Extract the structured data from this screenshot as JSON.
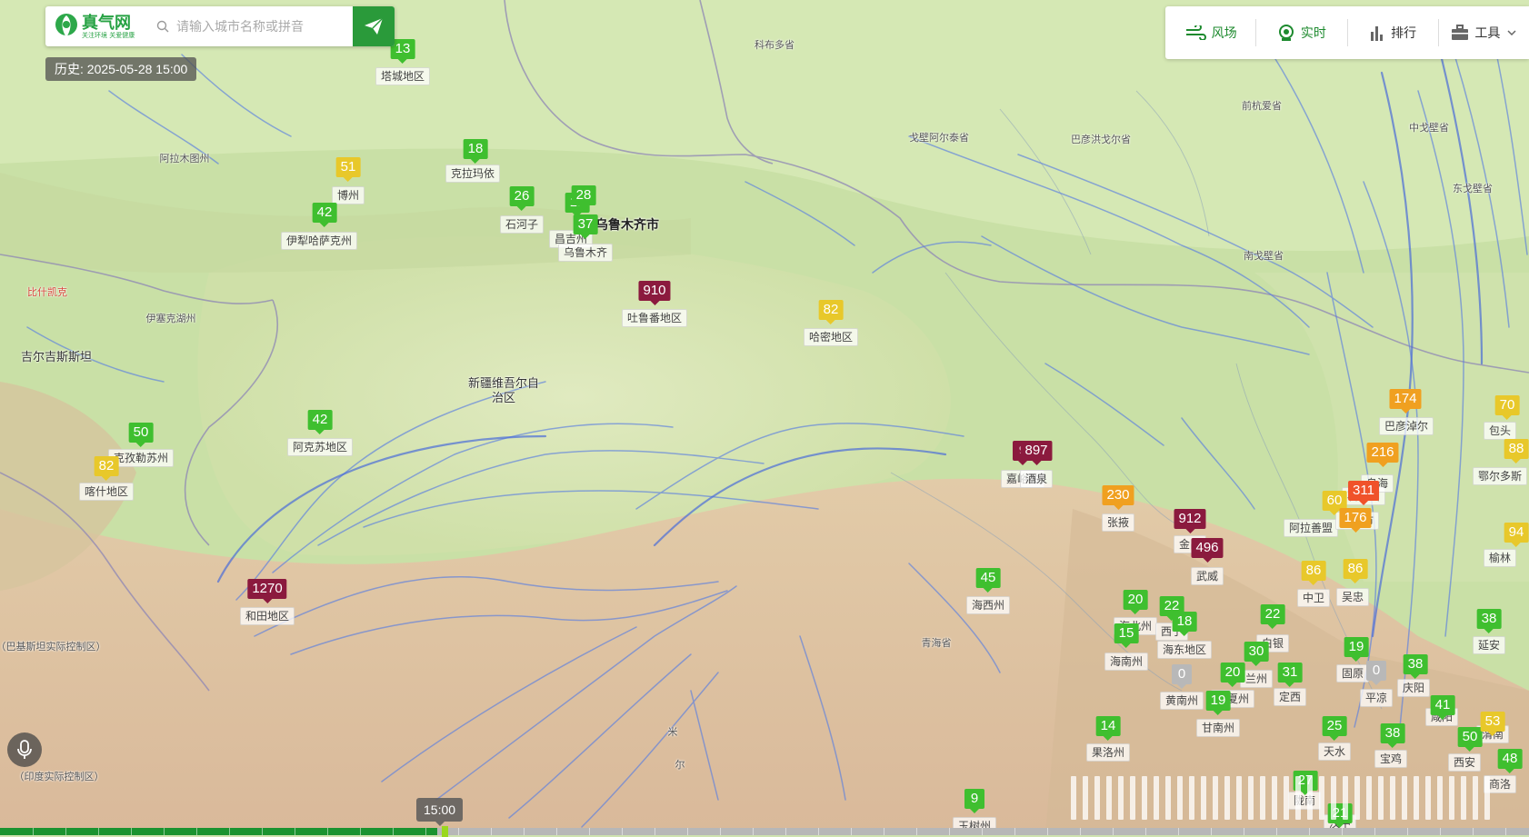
{
  "app": {
    "logo_title": "真气网",
    "logo_slogan": "关注环境 关爱健康",
    "search_placeholder": "请输入城市名称或拼音",
    "history_label": "历史: 2025-05-28 15:00"
  },
  "toolbar": [
    {
      "label": "风场",
      "icon": "wind-icon",
      "active": true
    },
    {
      "label": "实时",
      "icon": "monitor-icon",
      "active": true
    },
    {
      "label": "排行",
      "icon": "bar-chart-icon",
      "active": false
    },
    {
      "label": "工具",
      "icon": "toolbox-icon",
      "active": false
    }
  ],
  "timeline": {
    "current_time": "15:00"
  },
  "aqi_colors": {
    "good": "#3fbf2f",
    "moderate": "#e8c82a",
    "sensitive": "#f0a020",
    "unhealthy": "#f0522a",
    "very_unhealthy": "#b0245a",
    "hazardous": "#8b1a3e",
    "no_data": "#b8b8b8"
  },
  "regions": [
    "科布多省",
    "戈壁阿尔泰省",
    "巴彦洪戈尔省",
    "前杭爱省",
    "中戈壁省",
    "东戈壁省",
    "南戈壁省",
    "阿拉木图州",
    "伊塞克湖州",
    "吉尔吉斯斯坦",
    "比什凯克",
    "新疆维吾尔自治区",
    "青海省",
    "（巴基斯坦实际控制区）",
    "（印度实际控制区）",
    "米",
    "尔",
    "乌鲁木齐市",
    "吐鲁番地区"
  ],
  "stations": [
    {
      "name": "塔城地区",
      "aqi": 13,
      "level": "good"
    },
    {
      "name": "博州",
      "aqi": 51,
      "level": "moderate"
    },
    {
      "name": "伊犁哈萨克州",
      "aqi": 42,
      "level": "good"
    },
    {
      "name": "克拉玛依",
      "aqi": 18,
      "level": "good"
    },
    {
      "name": "石河子",
      "aqi": 26,
      "level": "good"
    },
    {
      "name": "昌吉州",
      "aqi": 19,
      "level": "good"
    },
    {
      "name": "",
      "aqi": 28,
      "level": "good"
    },
    {
      "name": "乌鲁木齐",
      "aqi": 37,
      "level": "good"
    },
    {
      "name": "吐鲁番地区",
      "aqi": 910,
      "level": "hazardous"
    },
    {
      "name": "哈密地区",
      "aqi": 82,
      "level": "moderate"
    },
    {
      "name": "克孜勒苏州",
      "aqi": 50,
      "level": "good"
    },
    {
      "name": "喀什地区",
      "aqi": 82,
      "level": "moderate"
    },
    {
      "name": "阿克苏地区",
      "aqi": 42,
      "level": "good"
    },
    {
      "name": "和田地区",
      "aqi": 1270,
      "level": "hazardous"
    },
    {
      "name": "嘉峪关",
      "aqi": 9,
      "level": "hazardous"
    },
    {
      "name": "酒泉",
      "aqi": 897,
      "level": "hazardous"
    },
    {
      "name": "张掖",
      "aqi": 230,
      "level": "sensitive"
    },
    {
      "name": "金昌",
      "aqi": 912,
      "level": "hazardous"
    },
    {
      "name": "武威",
      "aqi": 496,
      "level": "hazardous"
    },
    {
      "name": "海西州",
      "aqi": 45,
      "level": "good"
    },
    {
      "name": "海北州",
      "aqi": 20,
      "level": "good"
    },
    {
      "name": "西宁",
      "aqi": 22,
      "level": "good"
    },
    {
      "name": "海东地区",
      "aqi": 18,
      "level": "good"
    },
    {
      "name": "海南州",
      "aqi": 15,
      "level": "good"
    },
    {
      "name": "黄南州",
      "aqi": 0,
      "level": "no_data"
    },
    {
      "name": "临夏州",
      "aqi": 20,
      "level": "good"
    },
    {
      "name": "兰州",
      "aqi": 30,
      "level": "good"
    },
    {
      "name": "白银",
      "aqi": 22,
      "level": "good"
    },
    {
      "name": "定西",
      "aqi": 31,
      "level": "good"
    },
    {
      "name": "甘南州",
      "aqi": 19,
      "level": "good"
    },
    {
      "name": "果洛州",
      "aqi": 14,
      "level": "good"
    },
    {
      "name": "玉树州",
      "aqi": 9,
      "level": "good"
    },
    {
      "name": "阿拉善盟",
      "aqi": 60,
      "level": "moderate"
    },
    {
      "name": "中卫",
      "aqi": 86,
      "level": "moderate"
    },
    {
      "name": "吴忠",
      "aqi": 86,
      "level": "moderate"
    },
    {
      "name": "银川市",
      "aqi": 176,
      "level": "sensitive"
    },
    {
      "name": "石嘴山",
      "aqi": 311,
      "level": "unhealthy"
    },
    {
      "name": "乌海",
      "aqi": 216,
      "level": "sensitive"
    },
    {
      "name": "巴彦淖尔",
      "aqi": 174,
      "level": "sensitive"
    },
    {
      "name": "包头",
      "aqi": 70,
      "level": "moderate"
    },
    {
      "name": "鄂尔多斯",
      "aqi": 88,
      "level": "moderate"
    },
    {
      "name": "榆林",
      "aqi": 94,
      "level": "moderate"
    },
    {
      "name": "延安",
      "aqi": 38,
      "level": "good"
    },
    {
      "name": "固原",
      "aqi": 19,
      "level": "good"
    },
    {
      "name": "平凉",
      "aqi": 0,
      "level": "no_data"
    },
    {
      "name": "庆阳",
      "aqi": 38,
      "level": "good"
    },
    {
      "name": "天水",
      "aqi": 25,
      "level": "good"
    },
    {
      "name": "宝鸡",
      "aqi": 38,
      "level": "good"
    },
    {
      "name": "咸阳",
      "aqi": 41,
      "level": "good"
    },
    {
      "name": "西安",
      "aqi": 50,
      "level": "good"
    },
    {
      "name": "渭南",
      "aqi": 53,
      "level": "moderate"
    },
    {
      "name": "商洛",
      "aqi": 48,
      "level": "good"
    },
    {
      "name": "陇南",
      "aqi": 27,
      "level": "good"
    },
    {
      "name": "汉中",
      "aqi": 21,
      "level": "good"
    }
  ]
}
